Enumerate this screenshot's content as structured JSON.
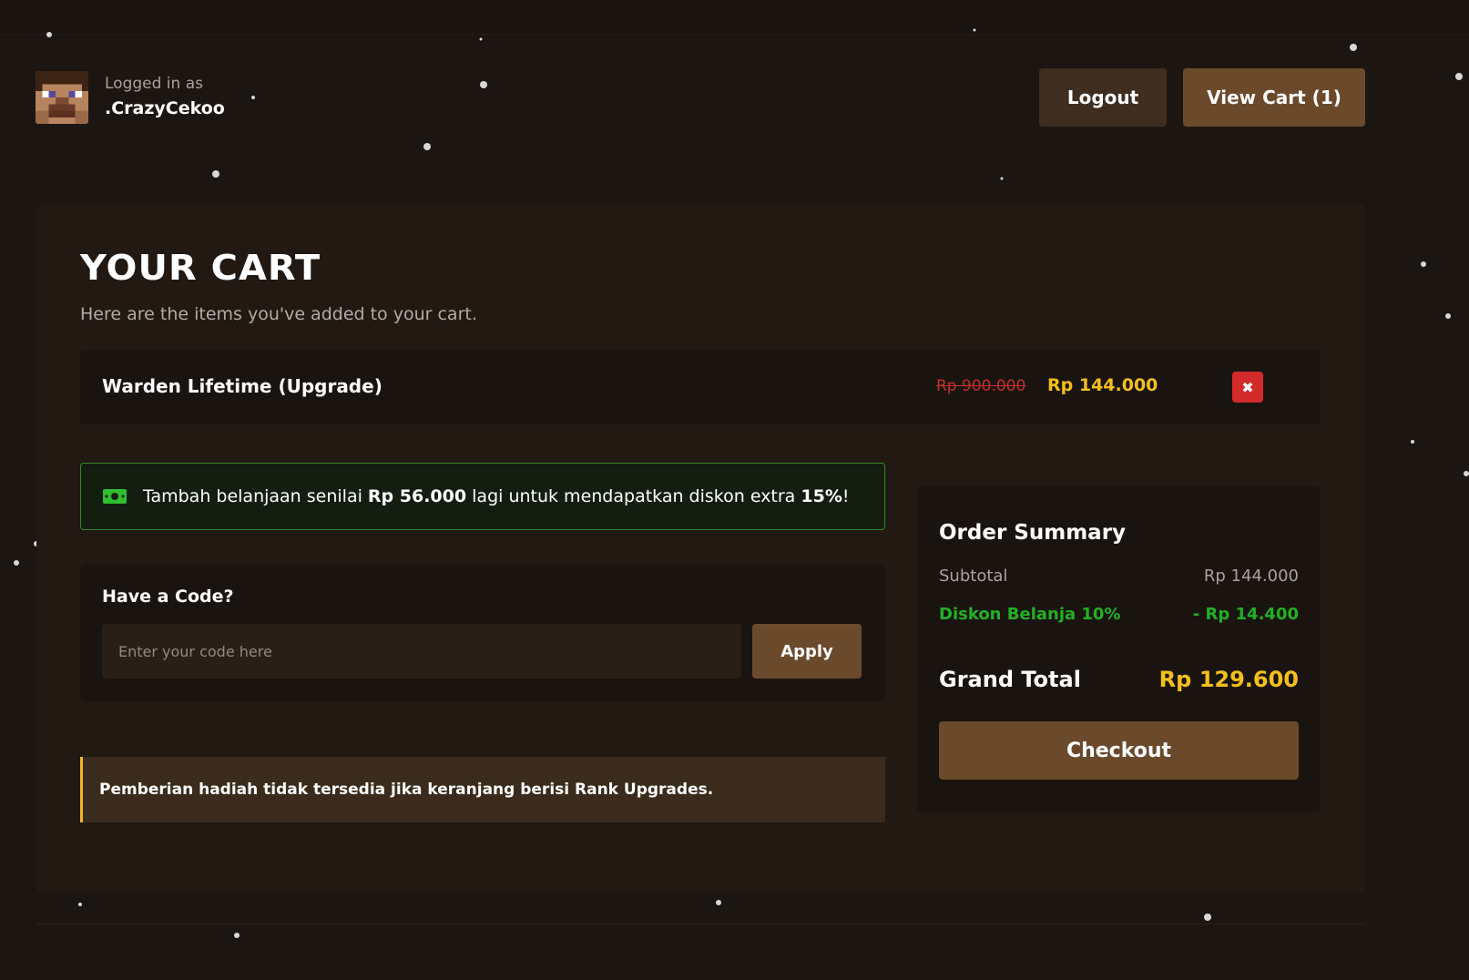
{
  "header": {
    "logged_in_label": "Logged in as",
    "username": ".CrazyCekoo",
    "logout_label": "Logout",
    "view_cart_label": "View Cart (1)"
  },
  "cart": {
    "title": "YOUR CART",
    "subtitle": "Here are the items you've added to your cart.",
    "items": [
      {
        "name": "Warden Lifetime (Upgrade)",
        "original_price": "Rp 900.000",
        "price": "Rp 144.000",
        "remove_icon": "close-icon"
      }
    ]
  },
  "promo": {
    "icon": "cash-icon",
    "text_before": "Tambah belanjaan senilai",
    "amount": "Rp 56.000",
    "text_middle": "lagi untuk mendapatkan diskon extra",
    "percent": "15%",
    "text_after": "!"
  },
  "code": {
    "title": "Have a Code?",
    "placeholder": "Enter your code here",
    "value": "",
    "apply_label": "Apply"
  },
  "warning": {
    "text": "Pemberian hadiah tidak tersedia jika keranjang berisi Rank Upgrades."
  },
  "summary": {
    "title": "Order Summary",
    "subtotal_label": "Subtotal",
    "subtotal_value": "Rp 144.000",
    "discount_label": "Diskon Belanja 10%",
    "discount_value": "- Rp 14.400",
    "grand_total_label": "Grand Total",
    "grand_total_value": "Rp 129.600",
    "checkout_label": "Checkout"
  },
  "colors": {
    "background": "#1c1612",
    "panel": "#211912",
    "button_brown": "#6b4a2c",
    "button_dark_brown": "#3f2e1f",
    "price_gold": "#f4bf1c",
    "strike_red": "#c0302a",
    "discount_green": "#23b023",
    "warning_accent": "#f0b429",
    "remove_red": "#d32a2a"
  }
}
